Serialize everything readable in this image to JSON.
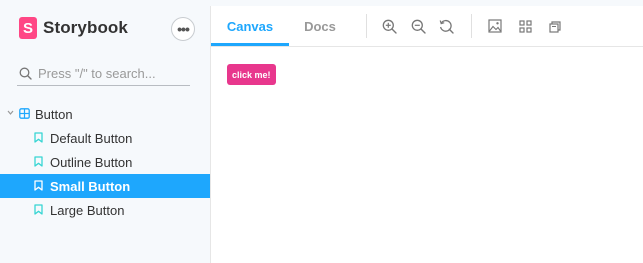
{
  "sidebar": {
    "brand": {
      "mark": "S",
      "name": "Storybook",
      "color": "#ff4785"
    },
    "menu_button": {
      "glyph": "•••",
      "icon": "ellipsis-icon"
    },
    "search": {
      "placeholder": "Press \"/\" to search...",
      "value": ""
    },
    "tree": {
      "group": {
        "label": "Button",
        "expanded": true,
        "icon": "component-icon"
      },
      "stories": [
        {
          "label": "Default Button",
          "selected": false,
          "icon": "bookmark-icon"
        },
        {
          "label": "Outline Button",
          "selected": false,
          "icon": "bookmark-icon"
        },
        {
          "label": "Small Button",
          "selected": true,
          "icon": "bookmark-icon"
        },
        {
          "label": "Large Button",
          "selected": false,
          "icon": "bookmark-icon"
        }
      ]
    }
  },
  "toolbar": {
    "tabs": [
      {
        "label": "Canvas",
        "active": true
      },
      {
        "label": "Docs",
        "active": false
      }
    ],
    "tools": [
      "zoom-in-icon",
      "zoom-out-icon",
      "reset-zoom-icon",
      "background-icon",
      "grid-icon",
      "viewport-icon"
    ]
  },
  "canvas": {
    "demo_button": {
      "label": "click me!",
      "color": "#e8378d"
    }
  },
  "colors": {
    "accent": "#1ea7fd",
    "sidebar_bg": "#f6f9fc"
  }
}
